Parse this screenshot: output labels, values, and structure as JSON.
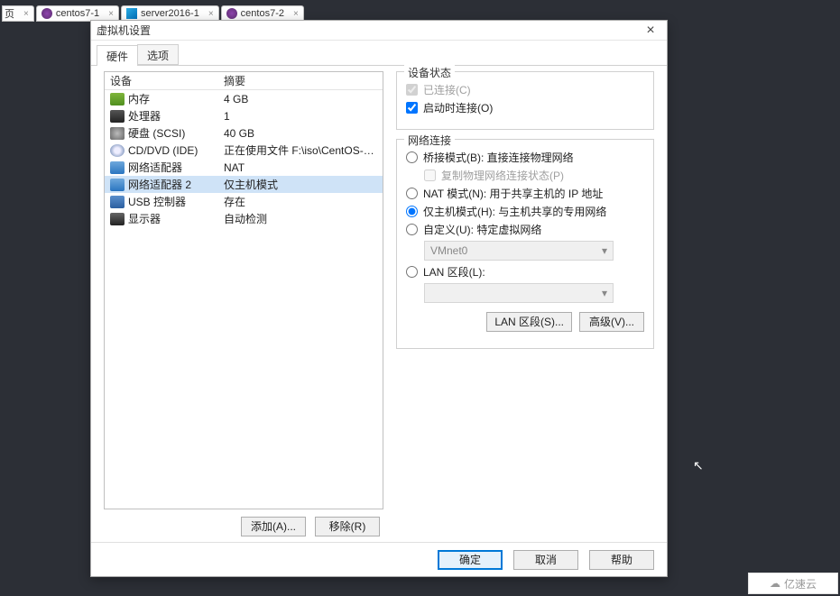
{
  "workspace_tabs": [
    {
      "label": "页",
      "icon": ""
    },
    {
      "label": "centos7-1",
      "icon": "centos"
    },
    {
      "label": "server2016-1",
      "icon": "win"
    },
    {
      "label": "centos7-2",
      "icon": "centos"
    }
  ],
  "dialog": {
    "title": "虚拟机设置",
    "tabs": {
      "hardware": "硬件",
      "options": "选项"
    },
    "hardware": {
      "header_device": "设备",
      "header_summary": "摘要",
      "rows": [
        {
          "icon": "mem",
          "name": "内存",
          "summary": "4 GB"
        },
        {
          "icon": "cpu",
          "name": "处理器",
          "summary": "1"
        },
        {
          "icon": "hdd",
          "name": "硬盘 (SCSI)",
          "summary": "40 GB"
        },
        {
          "icon": "cd",
          "name": "CD/DVD (IDE)",
          "summary": "正在使用文件 F:\\iso\\CentOS-7-..."
        },
        {
          "icon": "net",
          "name": "网络适配器",
          "summary": "NAT"
        },
        {
          "icon": "net",
          "name": "网络适配器 2",
          "summary": "仅主机模式",
          "selected": true
        },
        {
          "icon": "usb",
          "name": "USB 控制器",
          "summary": "存在"
        },
        {
          "icon": "disp",
          "name": "显示器",
          "summary": "自动检测"
        }
      ],
      "add_btn": "添加(A)...",
      "remove_btn": "移除(R)"
    },
    "right": {
      "device_status": {
        "legend": "设备状态",
        "connected": "已连接(C)",
        "connect_at_power_on": "启动时连接(O)"
      },
      "network_connection": {
        "legend": "网络连接",
        "bridged": "桥接模式(B): 直接连接物理网络",
        "replicate": "复制物理网络连接状态(P)",
        "nat": "NAT 模式(N): 用于共享主机的 IP 地址",
        "hostonly": "仅主机模式(H): 与主机共享的专用网络",
        "custom": "自定义(U): 特定虚拟网络",
        "custom_combo": "VMnet0",
        "lanseg": "LAN 区段(L):",
        "lanseg_btn": "LAN 区段(S)...",
        "advanced_btn": "高级(V)..."
      }
    },
    "footer": {
      "ok": "确定",
      "cancel": "取消",
      "help": "帮助"
    }
  },
  "watermark": "亿速云"
}
